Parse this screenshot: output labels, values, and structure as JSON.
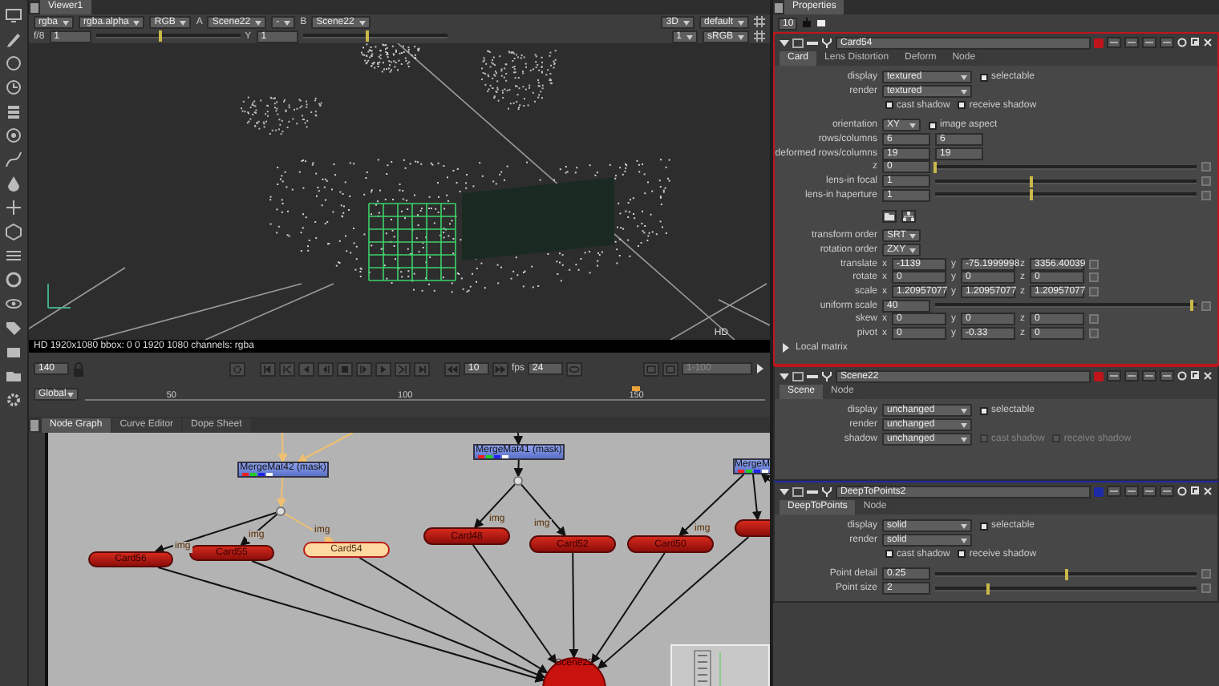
{
  "viewer": {
    "tab": "Viewer1",
    "row1_left": [
      {
        "kind": "dropdown",
        "text": "rgba"
      },
      {
        "kind": "dropdown",
        "text": "rgba.alpha"
      },
      {
        "kind": "dropdown",
        "text": "RGB"
      },
      {
        "kind": "label",
        "text": "A"
      },
      {
        "kind": "dropdown",
        "text": "Scene22"
      },
      {
        "kind": "dropdown",
        "text": "-"
      },
      {
        "kind": "label",
        "text": "B"
      },
      {
        "kind": "dropdown",
        "text": "Scene22"
      }
    ],
    "row1_right": [
      {
        "kind": "dropdown",
        "text": "3D"
      },
      {
        "kind": "dropdown",
        "text": "default"
      }
    ],
    "row2_left": [
      {
        "kind": "label",
        "text": "f/8"
      },
      {
        "kind": "field",
        "text": "1"
      },
      {
        "kind": "slider",
        "level": 0.45
      },
      {
        "kind": "label",
        "text": "Y"
      },
      {
        "kind": "field",
        "text": "1"
      },
      {
        "kind": "slider",
        "level": 0.45
      }
    ],
    "row2_right": [
      {
        "kind": "dropdown",
        "text": "1"
      },
      {
        "kind": "dropdown",
        "text": "sRGB"
      }
    ],
    "format_label": "HD",
    "info": "HD 1920x1080 bbox: 0 0 1920 1080 channels: rgba",
    "playback": {
      "frame": "140",
      "increment": "10",
      "fps_label": "fps",
      "fps": "24",
      "range": "1-100"
    },
    "timeline": {
      "mode": "Global",
      "ticks": [
        "50",
        "100",
        "150"
      ],
      "level": 0.81
    }
  },
  "node_graph": {
    "tabs": [
      {
        "label": "Node Graph",
        "selected": true
      },
      {
        "label": "Curve Editor",
        "selected": false
      },
      {
        "label": "Dope Sheet",
        "selected": false
      }
    ],
    "nodes": [
      {
        "kind": "merge",
        "label": "MergeMat42 (mask)",
        "selected": false
      },
      {
        "kind": "merge",
        "label": "MergeMat41 (mask)",
        "selected": false
      },
      {
        "kind": "merge",
        "label": "MergeM",
        "selected": false
      },
      {
        "kind": "dot",
        "selected": false
      },
      {
        "kind": "dot",
        "selected": false
      },
      {
        "kind": "card",
        "label": "Card56",
        "selected": false
      },
      {
        "kind": "card",
        "label": "Card55",
        "selected": false
      },
      {
        "kind": "card",
        "label": "Card54",
        "selected": true
      },
      {
        "kind": "card",
        "label": "Card48",
        "selected": false
      },
      {
        "kind": "card",
        "label": "Card52",
        "selected": false
      },
      {
        "kind": "card",
        "label": "Card50",
        "selected": false
      },
      {
        "kind": "card",
        "selected": false
      },
      {
        "kind": "scene",
        "label": "Scene22",
        "selected": false
      }
    ],
    "input_labels": [
      "img",
      "img",
      "img",
      "img",
      "img",
      "img"
    ]
  },
  "properties": {
    "title": "Properties",
    "count": "10",
    "panels": [
      {
        "name": "Card54",
        "color": "#c0141c",
        "selected": true,
        "tabs": [
          {
            "label": "Card",
            "selected": true
          },
          {
            "label": "Lens Distortion",
            "selected": false
          },
          {
            "label": "Deform",
            "selected": false
          },
          {
            "label": "Node",
            "selected": false
          }
        ],
        "rows": [
          {
            "kind": "dropdown",
            "label": "display",
            "value": "textured",
            "checks": [
              {
                "label": "selectable",
                "checked": true,
                "disabled": false
              }
            ]
          },
          {
            "kind": "dropdown",
            "label": "render",
            "value": "textured"
          },
          {
            "kind": "checks",
            "checks": [
              {
                "label": "cast shadow",
                "checked": true,
                "disabled": false
              },
              {
                "label": "receive shadow",
                "checked": true,
                "disabled": false
              }
            ]
          },
          {
            "kind": "dropdown",
            "label": "orientation",
            "value": "XY",
            "checks": [
              {
                "label": "image aspect",
                "checked": true,
                "disabled": false
              }
            ]
          },
          {
            "kind": "fields",
            "label": "rows/columns",
            "values": [
              "6",
              "6"
            ]
          },
          {
            "kind": "fields",
            "label": "deformed rows/columns",
            "values": [
              "19",
              "19"
            ]
          },
          {
            "kind": "slider",
            "label": "z",
            "value": "0",
            "level": 0
          },
          {
            "kind": "slider",
            "label": "lens-in focal",
            "value": "1",
            "level": 0.37
          },
          {
            "kind": "slider",
            "label": "lens-in haperture",
            "value": "1",
            "level": 0.37
          },
          {
            "kind": "icons"
          },
          {
            "kind": "dropdown",
            "label": "transform order",
            "value": "SRT"
          },
          {
            "kind": "dropdown",
            "label": "rotation order",
            "value": "ZXY"
          },
          {
            "kind": "xyz",
            "label": "translate",
            "axes": [
              "x",
              "y",
              "z"
            ],
            "values": [
              "-1139",
              "-75.1999998",
              "3356.40039"
            ]
          },
          {
            "kind": "xyz",
            "label": "rotate",
            "axes": [
              "x",
              "y",
              "z"
            ],
            "values": [
              "0",
              "0",
              "0"
            ]
          },
          {
            "kind": "xyz",
            "label": "scale",
            "axes": [
              "x",
              "y",
              "z"
            ],
            "values": [
              "1.20957077",
              "1.20957077",
              "1.20957077"
            ]
          },
          {
            "kind": "slider",
            "label": "uniform scale",
            "value": "40",
            "level": 0.98
          },
          {
            "kind": "xyz",
            "label": "skew",
            "axes": [
              "x",
              "y",
              "z"
            ],
            "values": [
              "0",
              "0",
              "0"
            ]
          },
          {
            "kind": "xyz",
            "label": "pivot",
            "axes": [
              "x",
              "y",
              "z"
            ],
            "values": [
              "0",
              "-0.33",
              "0"
            ]
          },
          {
            "kind": "group",
            "label": "Local matrix",
            "expanded": false
          }
        ]
      },
      {
        "name": "Scene22",
        "color": "#c0141c",
        "selected": false,
        "tabs": [
          {
            "label": "Scene",
            "selected": true
          },
          {
            "label": "Node",
            "selected": false
          }
        ],
        "rows": [
          {
            "kind": "dropdown",
            "label": "display",
            "value": "unchanged",
            "checks": [
              {
                "label": "selectable",
                "checked": true,
                "disabled": false
              }
            ]
          },
          {
            "kind": "dropdown",
            "label": "render",
            "value": "unchanged"
          },
          {
            "kind": "dropdown",
            "label": "shadow",
            "value": "unchanged",
            "checks": [
              {
                "label": "cast shadow",
                "checked": false,
                "disabled": true
              },
              {
                "label": "receive shadow",
                "checked": false,
                "disabled": true
              }
            ]
          }
        ]
      },
      {
        "name": "DeepToPoints2",
        "color": "#1c2aa8",
        "selected": false,
        "tabs": [
          {
            "label": "DeepToPoints",
            "selected": true
          },
          {
            "label": "Node",
            "selected": false
          }
        ],
        "rows": [
          {
            "kind": "dropdown",
            "label": "display",
            "value": "solid",
            "checks": [
              {
                "label": "selectable",
                "checked": true,
                "disabled": false
              }
            ]
          },
          {
            "kind": "dropdown",
            "label": "render",
            "value": "solid"
          },
          {
            "kind": "checks",
            "checks": [
              {
                "label": "cast shadow",
                "checked": true,
                "disabled": false
              },
              {
                "label": "receive shadow",
                "checked": true,
                "disabled": false
              }
            ]
          },
          {
            "kind": "slider",
            "label": "Point detail",
            "value": "0.25",
            "level": 0.5
          },
          {
            "kind": "slider",
            "label": "Point size",
            "value": "2",
            "level": 0.2
          }
        ]
      }
    ]
  }
}
